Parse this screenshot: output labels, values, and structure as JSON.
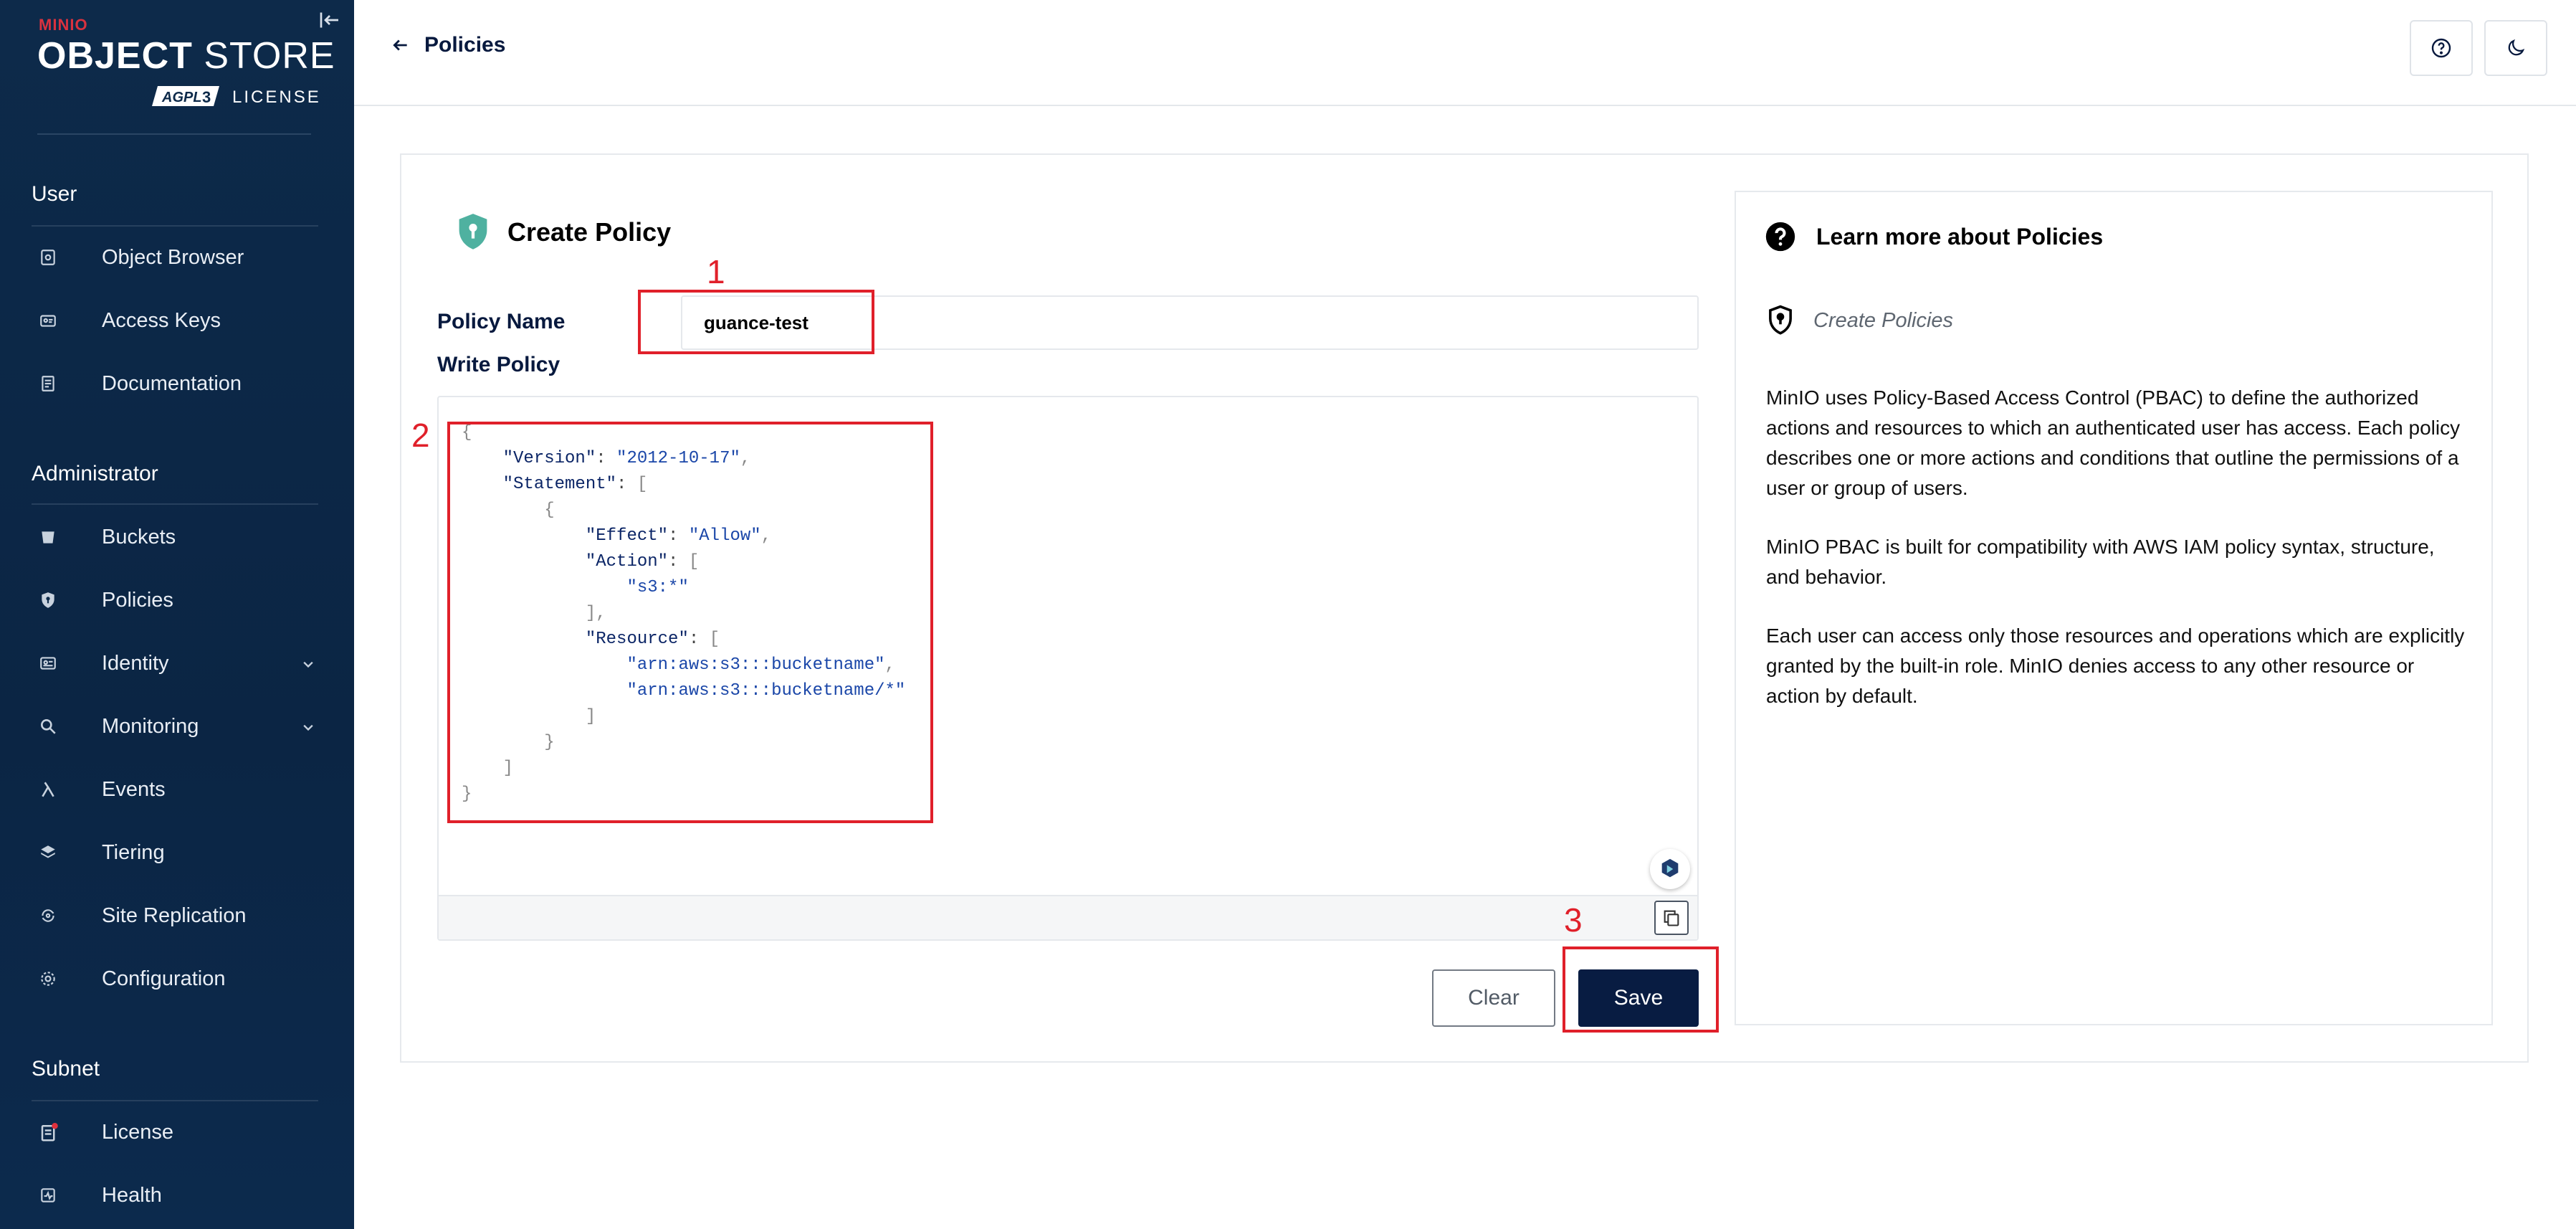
{
  "logo": {
    "brand_prefix": "MIN",
    "brand_suffix": "IO",
    "product_bold": "OBJECT",
    "product_thin": "STORE",
    "license_badge": "AGPL",
    "license_word": "LICENSE"
  },
  "sidebar": {
    "sections": [
      {
        "title": "User",
        "items": [
          {
            "label": "Object Browser",
            "icon": "object-browser-icon"
          },
          {
            "label": "Access Keys",
            "icon": "access-keys-icon"
          },
          {
            "label": "Documentation",
            "icon": "documentation-icon"
          }
        ]
      },
      {
        "title": "Administrator",
        "items": [
          {
            "label": "Buckets",
            "icon": "bucket-icon"
          },
          {
            "label": "Policies",
            "icon": "policies-icon"
          },
          {
            "label": "Identity",
            "icon": "identity-icon",
            "expandable": true
          },
          {
            "label": "Monitoring",
            "icon": "monitoring-icon",
            "expandable": true
          },
          {
            "label": "Events",
            "icon": "lambda-icon"
          },
          {
            "label": "Tiering",
            "icon": "tiering-icon"
          },
          {
            "label": "Site Replication",
            "icon": "site-replication-icon"
          },
          {
            "label": "Configuration",
            "icon": "gear-icon"
          }
        ]
      },
      {
        "title": "Subnet",
        "items": [
          {
            "label": "License",
            "icon": "license-icon"
          },
          {
            "label": "Health",
            "icon": "health-icon"
          }
        ]
      }
    ]
  },
  "topbar": {
    "back_label": "Policies"
  },
  "form": {
    "title": "Create Policy",
    "policy_name_label": "Policy Name",
    "policy_name_value": "guance-test",
    "write_policy_label": "Write Policy",
    "code_lines": [
      "{",
      "    \"Version\": \"2012-10-17\",",
      "    \"Statement\": [",
      "        {",
      "            \"Effect\": \"Allow\",",
      "            \"Action\": [",
      "                \"s3:*\"",
      "            ],",
      "            \"Resource\": [",
      "                \"arn:aws:s3:::bucketname\",",
      "                \"arn:aws:s3:::bucketname/*\"",
      "            ]",
      "        }",
      "    ]",
      "}"
    ],
    "clear_label": "Clear",
    "save_label": "Save"
  },
  "help": {
    "title": "Learn more about Policies",
    "subtitle": "Create Policies",
    "p1": "MinIO uses Policy-Based Access Control (PBAC) to define the authorized actions and resources to which an authenticated user has access. Each policy describes one or more actions and conditions that outline the permissions of a user or group of users.",
    "p2": "MinIO PBAC is built for compatibility with AWS IAM policy syntax, structure, and behavior.",
    "p3": "Each user can access only those resources and operations which are explicitly granted by the built-in role. MinIO denies access to any other resource or action by default."
  },
  "annotations": {
    "n1": "1",
    "n2": "2",
    "n3": "3",
    "color": "#e0202a"
  },
  "colors": {
    "sidebar": "#0d2a4a",
    "primary": "#081c42",
    "brand_red": "#d9323f"
  }
}
